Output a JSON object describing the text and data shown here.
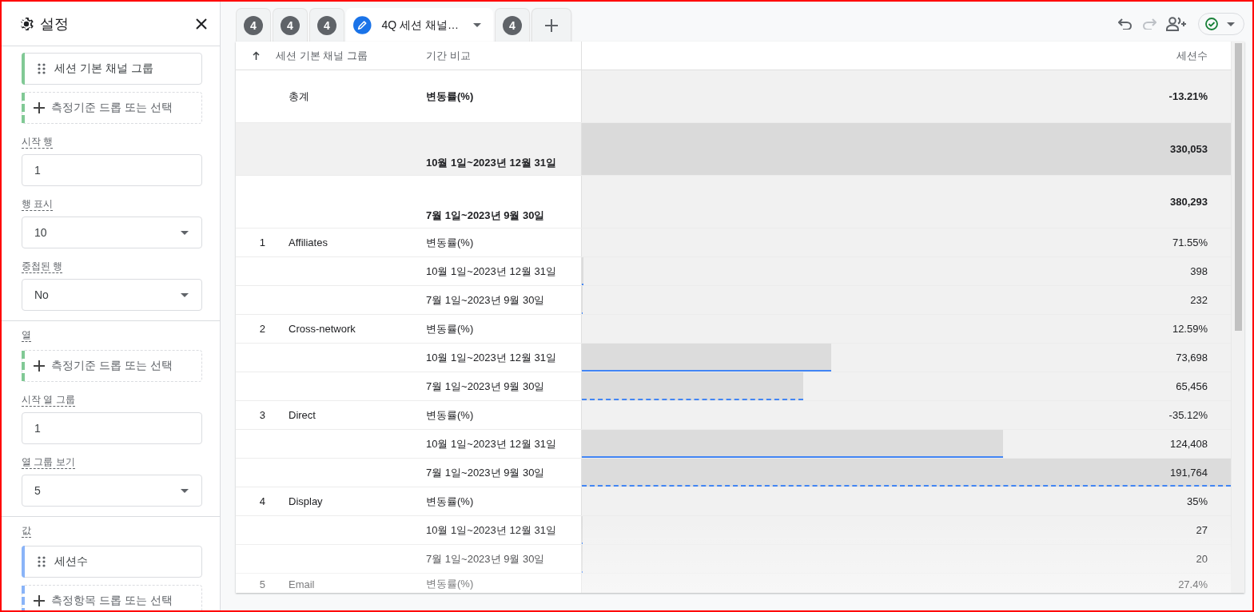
{
  "settings": {
    "title": "설정",
    "sections": [
      {
        "items": [
          {
            "kind": "chip",
            "text": "세션 기본 채널 그룹",
            "color": "#81c995"
          },
          {
            "kind": "dropzone",
            "text": "측정기준 드롭 또는 선택",
            "color": "#81c995"
          },
          {
            "kind": "input",
            "label": "시작 행",
            "value": "1"
          },
          {
            "kind": "select",
            "label": "행 표시",
            "value": "10"
          },
          {
            "kind": "select",
            "label": "중첩된 행",
            "value": "No"
          }
        ]
      },
      {
        "items": [
          {
            "kind": "heading",
            "text": "열"
          },
          {
            "kind": "dropzone",
            "text": "측정기준 드롭 또는 선택",
            "color": "#81c995"
          },
          {
            "kind": "input",
            "label": "시작 열 그룹",
            "value": "1"
          },
          {
            "kind": "select",
            "label": "열 그룹 보기",
            "value": "5"
          }
        ]
      },
      {
        "items": [
          {
            "kind": "heading",
            "text": "값"
          },
          {
            "kind": "chip",
            "text": "세션수",
            "color": "#8ab4f8"
          },
          {
            "kind": "dropzone",
            "text": "측정항목 드롭 또는 선택",
            "color": "#8ab4f8"
          }
        ]
      }
    ]
  },
  "tabs": [
    {
      "kind": "badge",
      "label": "4",
      "selected": false
    },
    {
      "kind": "badge",
      "label": "4",
      "selected": false
    },
    {
      "kind": "badge",
      "label": "4",
      "selected": false
    },
    {
      "kind": "edit",
      "label": "4Q 세션 채널…",
      "selected": true
    },
    {
      "kind": "badge",
      "label": "4",
      "selected": false
    },
    {
      "kind": "add",
      "selected": false
    }
  ],
  "toolbar": [
    {
      "kind": "undo",
      "disabled": false
    },
    {
      "kind": "redo",
      "disabled": true
    },
    {
      "kind": "share",
      "disabled": false
    },
    {
      "kind": "status",
      "disabled": false
    }
  ],
  "table": {
    "columns": [
      "세션 기본 채널 그룹",
      "기간 비교",
      "세션수"
    ],
    "totals": [
      {
        "dimension": "총계",
        "period": "변동률(%)",
        "value": "-13.21%",
        "kind": "change",
        "highlighted": false
      },
      {
        "period": "10월 1일~2023년 12월 31일",
        "value": "330,053",
        "kind": "current",
        "highlighted": true
      },
      {
        "period": "7월 1일~2023년 9월 30일",
        "value": "380,293",
        "kind": "previous",
        "highlighted": false
      }
    ],
    "rows": [
      {
        "index": "1",
        "dimension": "Affiliates",
        "period": "변동률(%)",
        "value": "71.55%",
        "kind": "change",
        "highlighted": false
      },
      {
        "period": "10월 1일~2023년 12월 31일",
        "value": "398",
        "kind": "current",
        "level": 0.0021,
        "highlighted": false
      },
      {
        "period": "7월 1일~2023년 9월 30일",
        "value": "232",
        "kind": "previous",
        "level": 0.0012,
        "highlighted": false
      },
      {
        "index": "2",
        "dimension": "Cross-network",
        "period": "변동률(%)",
        "value": "12.59%",
        "kind": "change",
        "highlighted": false
      },
      {
        "period": "10월 1일~2023년 12월 31일",
        "value": "73,698",
        "kind": "current",
        "level": 0.3843,
        "highlighted": false
      },
      {
        "period": "7월 1일~2023년 9월 30일",
        "value": "65,456",
        "kind": "previous",
        "level": 0.3413,
        "highlighted": false
      },
      {
        "index": "3",
        "dimension": "Direct",
        "period": "변동률(%)",
        "value": "-35.12%",
        "kind": "change",
        "highlighted": false
      },
      {
        "period": "10월 1일~2023년 12월 31일",
        "value": "124,408",
        "kind": "current",
        "level": 0.6488,
        "highlighted": false
      },
      {
        "period": "7월 1일~2023년 9월 30일",
        "value": "191,764",
        "kind": "previous",
        "level": 1,
        "highlighted": false
      },
      {
        "index": "4",
        "dimension": "Display",
        "period": "변동률(%)",
        "value": "35%",
        "kind": "change",
        "highlighted": false
      },
      {
        "period": "10월 1일~2023년 12월 31일",
        "value": "27",
        "kind": "current",
        "level": 0.0001,
        "highlighted": false
      },
      {
        "period": "7월 1일~2023년 9월 30일",
        "value": "20",
        "kind": "previous",
        "level": 0.0001,
        "highlighted": false
      },
      {
        "index": "5",
        "dimension": "Email",
        "period": "변동률(%)",
        "value": "27.4%",
        "kind": "change",
        "highlighted": false
      }
    ]
  }
}
